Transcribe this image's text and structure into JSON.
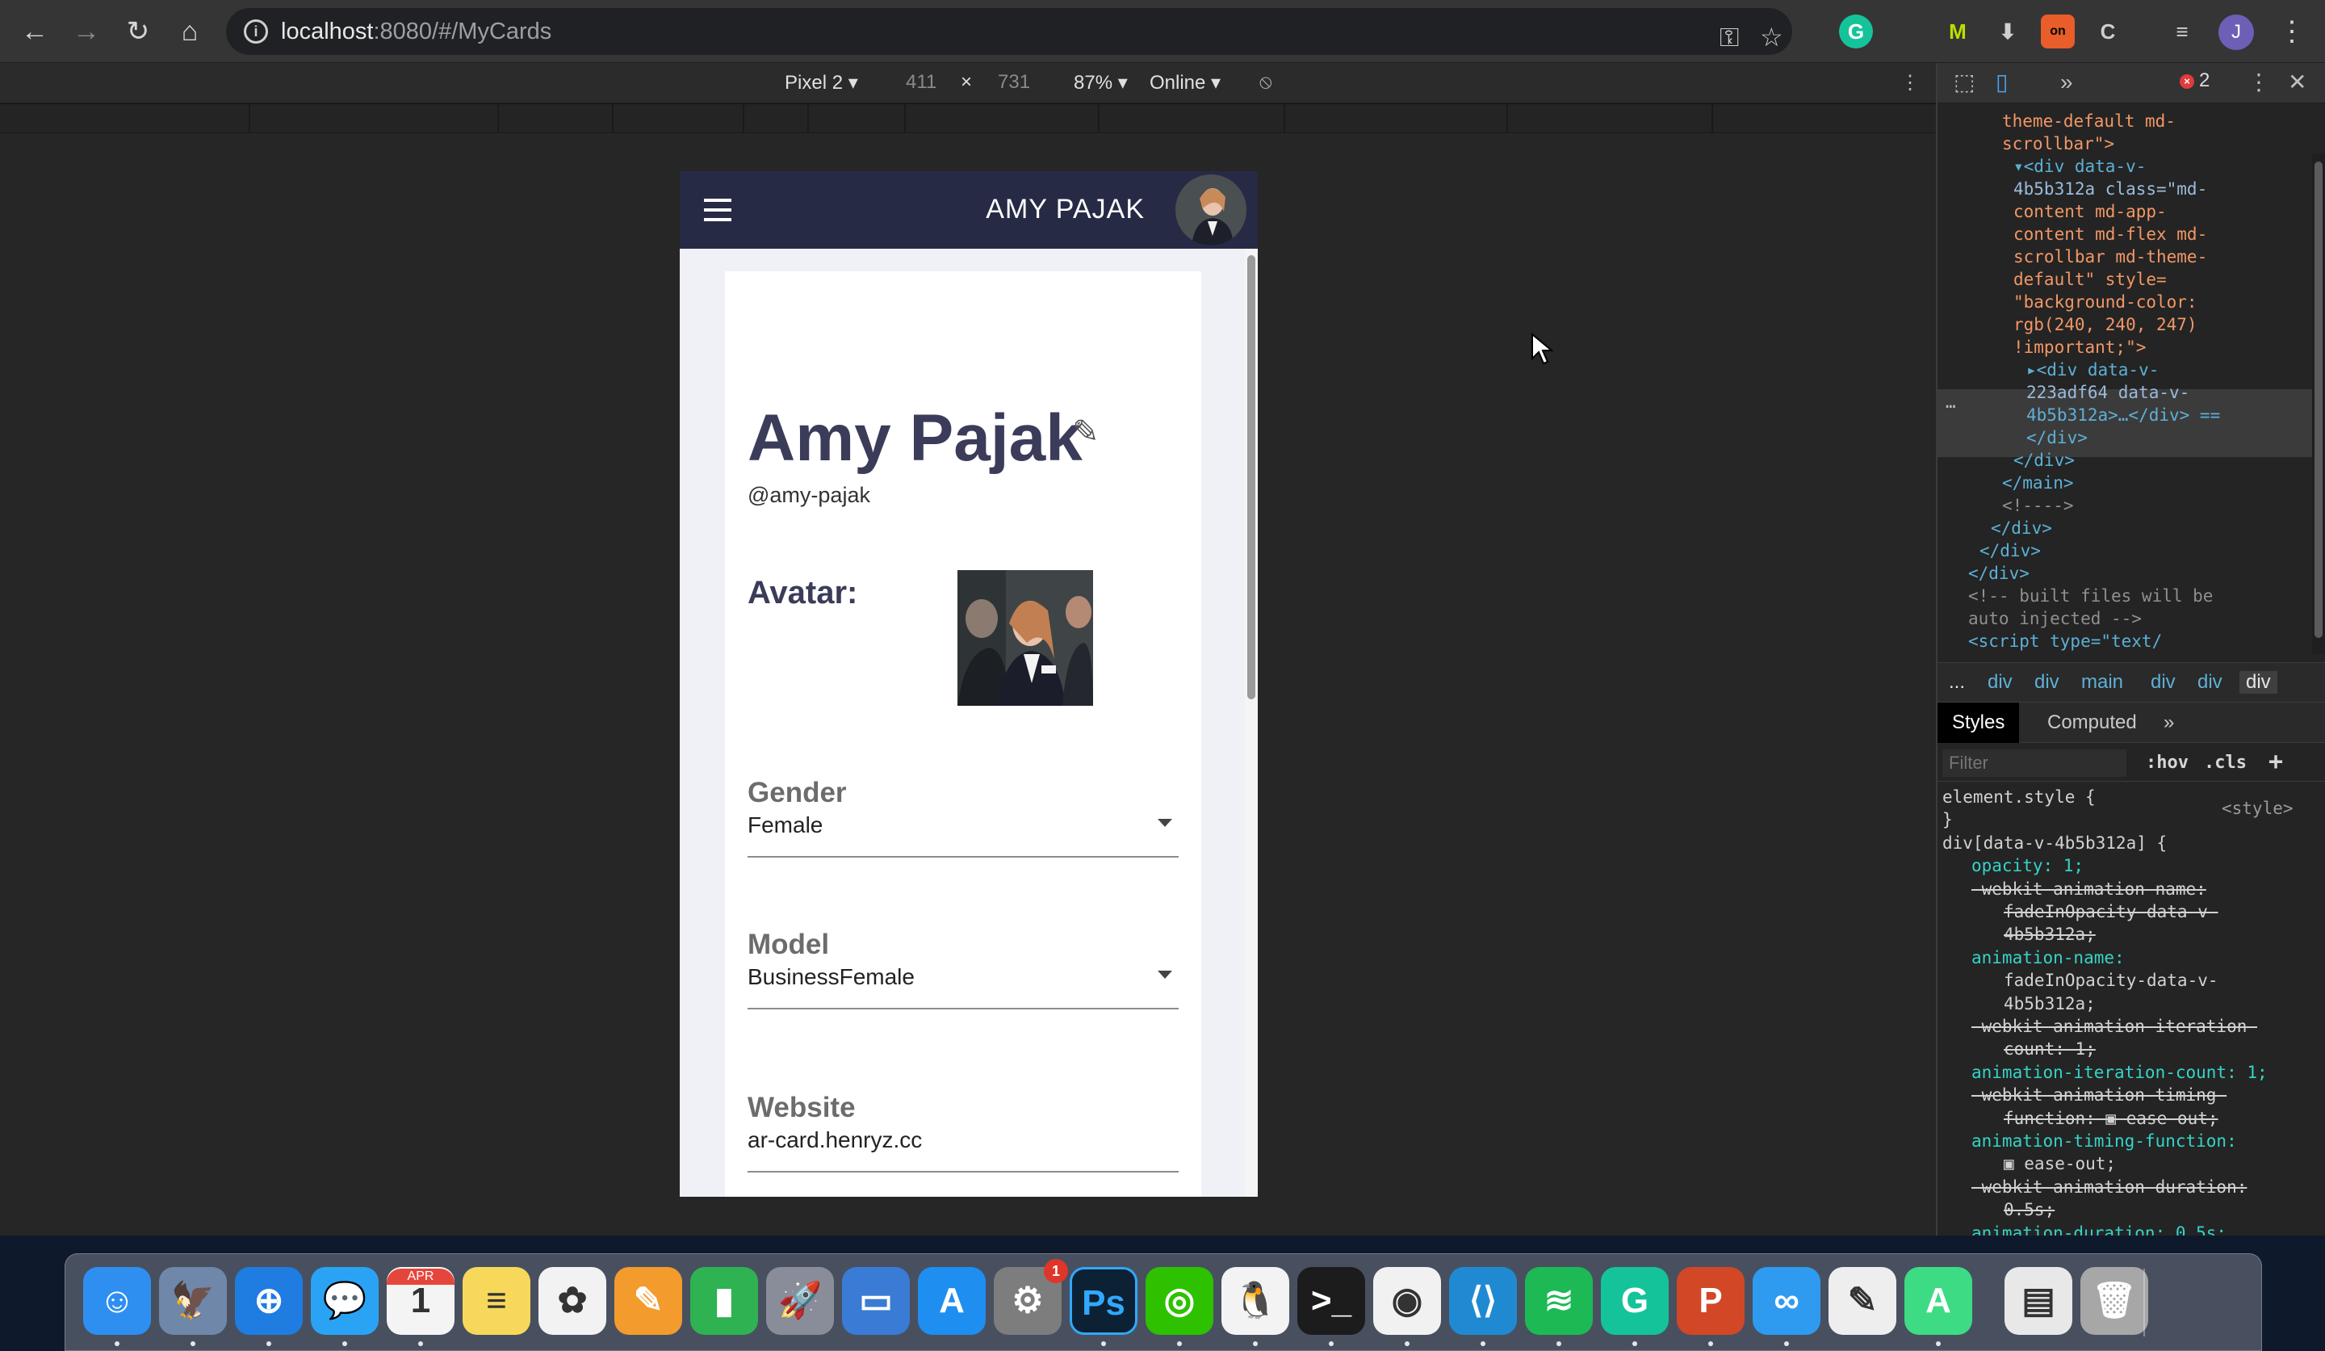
{
  "browser": {
    "url_host": "localhost",
    "url_rest": ":8080/#/MyCards",
    "profile_initial": "J",
    "extensions": [
      "M",
      "on"
    ]
  },
  "device_toolbar": {
    "device": "Pixel 2",
    "width": "411",
    "separator": "×",
    "height": "731",
    "zoom": "87%",
    "network": "Online"
  },
  "app": {
    "header_title": "AMY PAJAK",
    "name": "Amy Pajak",
    "handle": "@amy-pajak",
    "avatar_label": "Avatar:",
    "fields": [
      {
        "label": "Gender",
        "value": "Female"
      },
      {
        "label": "Model",
        "value": "BusinessFemale"
      },
      {
        "label": "Website",
        "value": "ar-card.henryz.cc"
      }
    ]
  },
  "devtools": {
    "error_count": "2",
    "breadcrumbs": [
      "...",
      "div",
      "div",
      "main",
      "div",
      "div",
      "div"
    ],
    "tabs": [
      "Styles",
      "Computed"
    ],
    "filter_placeholder": "Filter",
    "filter_buttons": [
      ":hov",
      ".cls",
      "+"
    ],
    "dom_lines": [
      {
        "text": "theme-default md-",
        "cls": "t-val",
        "indent": 80
      },
      {
        "text": "scrollbar\">",
        "cls": "t-val",
        "indent": 80
      },
      {
        "text": "▾<div data-v-",
        "cls": "t-tag",
        "indent": 94
      },
      {
        "text": "4b5b312a class=\"md-",
        "cls": "t-attr",
        "indent": 94
      },
      {
        "text": "content md-app-",
        "cls": "t-val",
        "indent": 94
      },
      {
        "text": "content md-flex md-",
        "cls": "t-val",
        "indent": 94
      },
      {
        "text": "scrollbar md-theme-",
        "cls": "t-val",
        "indent": 94
      },
      {
        "text": "default\" style=",
        "cls": "t-val",
        "indent": 94
      },
      {
        "text": "\"background-color:",
        "cls": "t-val",
        "indent": 94
      },
      {
        "text": "rgb(240, 240, 247)",
        "cls": "t-val",
        "indent": 94
      },
      {
        "text": "!important;\">",
        "cls": "t-val",
        "indent": 94
      },
      {
        "text": "▸<div data-v-",
        "cls": "t-tag",
        "indent": 110
      },
      {
        "text": "223adf64 data-v-",
        "cls": "t-attr",
        "indent": 110
      },
      {
        "text": "4b5b312a>…</div> ==",
        "cls": "t-tag",
        "indent": 110
      },
      {
        "text": "</div>",
        "cls": "t-tag",
        "indent": 110
      },
      {
        "text": "</div>",
        "cls": "t-tag",
        "indent": 94
      },
      {
        "text": "</main>",
        "cls": "t-tag",
        "indent": 80
      },
      {
        "text": "<!---->",
        "cls": "t-comment",
        "indent": 80
      },
      {
        "text": "</div>",
        "cls": "t-tag",
        "indent": 66
      },
      {
        "text": "</div>",
        "cls": "t-tag",
        "indent": 52
      },
      {
        "text": "</div>",
        "cls": "t-tag",
        "indent": 38
      },
      {
        "text": "<!-- built files will be",
        "cls": "t-comment",
        "indent": 38
      },
      {
        "text": "auto injected -->",
        "cls": "t-comment",
        "indent": 38
      },
      {
        "text": "<script type=\"text/",
        "cls": "t-tag",
        "indent": 38
      }
    ],
    "style_lines": [
      {
        "text": "element.style {",
        "kind": "plain",
        "indent": 6
      },
      {
        "text": "}",
        "kind": "plain",
        "indent": 6
      },
      {
        "text": "div[data-v-4b5b312a] {",
        "kind": "plain",
        "indent": 6
      },
      {
        "text": "opacity: 1;",
        "kind": "prop",
        "indent": 42
      },
      {
        "text": "-webkit-animation-name:",
        "kind": "strike",
        "indent": 42
      },
      {
        "text": "fadeInOpacity-data-v-",
        "kind": "strike",
        "indent": 82
      },
      {
        "text": "4b5b312a;",
        "kind": "strike",
        "indent": 82
      },
      {
        "text": "animation-name:",
        "kind": "prop",
        "indent": 42
      },
      {
        "text": "fadeInOpacity-data-v-",
        "kind": "plain",
        "indent": 82
      },
      {
        "text": "4b5b312a;",
        "kind": "plain",
        "indent": 82
      },
      {
        "text": "-webkit-animation-iteration-",
        "kind": "strike",
        "indent": 42
      },
      {
        "text": "count: 1;",
        "kind": "strike",
        "indent": 82
      },
      {
        "text": "animation-iteration-count: 1;",
        "kind": "prop",
        "indent": 42
      },
      {
        "text": "-webkit-animation-timing-",
        "kind": "strike",
        "indent": 42
      },
      {
        "text": "function: ▣ ease-out;",
        "kind": "strike",
        "indent": 82
      },
      {
        "text": "animation-timing-function:",
        "kind": "prop",
        "indent": 42
      },
      {
        "text": "▣ ease-out;",
        "kind": "plain",
        "indent": 82
      },
      {
        "text": "-webkit-animation-duration:",
        "kind": "strike",
        "indent": 42
      },
      {
        "text": "0.5s;",
        "kind": "strike",
        "indent": 82
      },
      {
        "text": "animation-duration: 0.5s;",
        "kind": "prop",
        "indent": 42
      }
    ],
    "style_source": "<style>"
  },
  "dock": {
    "apps": [
      {
        "name": "finder-icon",
        "glyph": "☺",
        "color": "#2f8ff0"
      },
      {
        "name": "preview-icon",
        "glyph": "🦅",
        "color": "#6f87a8"
      },
      {
        "name": "safari-icon",
        "glyph": "⊕",
        "color": "#1f7ce0"
      },
      {
        "name": "messages-icon",
        "glyph": "💬",
        "color": "#2aa3f5"
      },
      {
        "name": "calendar-icon",
        "glyph": "1",
        "color": "#f4f4f4"
      },
      {
        "name": "notes-icon",
        "glyph": "≡",
        "color": "#f7d85a"
      },
      {
        "name": "photos-icon",
        "glyph": "✿",
        "color": "#f2f2f2"
      },
      {
        "name": "pages-icon",
        "glyph": "✎",
        "color": "#f39b2c"
      },
      {
        "name": "numbers-icon",
        "glyph": "▮",
        "color": "#2fb251"
      },
      {
        "name": "launchpad-icon",
        "glyph": "🚀",
        "color": "#888d99"
      },
      {
        "name": "keynote-icon",
        "glyph": "▭",
        "color": "#3a7bd5"
      },
      {
        "name": "app-store-icon",
        "glyph": "A",
        "color": "#1e8ef0"
      },
      {
        "name": "system-preferences-icon",
        "glyph": "⚙",
        "color": "#7d7d7d"
      },
      {
        "name": "photoshop-icon",
        "glyph": "Ps",
        "color": "#0c2133"
      },
      {
        "name": "wechat-icon",
        "glyph": "◎",
        "color": "#2dc100"
      },
      {
        "name": "qq-icon",
        "glyph": "🐧",
        "color": "#f3f3f3"
      },
      {
        "name": "terminal-icon",
        "glyph": ">_",
        "color": "#1c1c1c"
      },
      {
        "name": "chrome-icon",
        "glyph": "◉",
        "color": "#f1f1f1"
      },
      {
        "name": "vscode-icon",
        "glyph": "⟨⟩",
        "color": "#1f8ad2"
      },
      {
        "name": "spotify-icon",
        "glyph": "≋",
        "color": "#1db954"
      },
      {
        "name": "grammarly-icon",
        "glyph": "G",
        "color": "#15c39a"
      },
      {
        "name": "powerpoint-icon",
        "glyph": "P",
        "color": "#d24726"
      },
      {
        "name": "teams-icon",
        "glyph": "∞",
        "color": "#2e9bf0"
      },
      {
        "name": "textedit-icon",
        "glyph": "✎",
        "color": "#eeeeee"
      },
      {
        "name": "android-studio-icon",
        "glyph": "A",
        "color": "#3ddc84"
      },
      {
        "name": "html-file-icon",
        "glyph": "▤",
        "color": "#e8e8e8"
      },
      {
        "name": "trash-icon",
        "glyph": "🗑",
        "color": "#a7a7a7"
      }
    ],
    "calendar_month": "APR",
    "system_prefs_badge": "1"
  }
}
